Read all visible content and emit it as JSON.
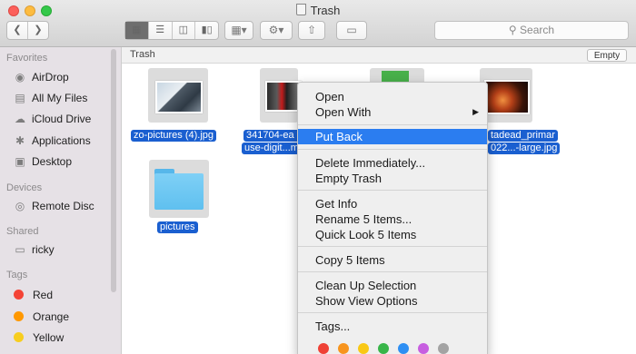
{
  "window": {
    "title": "Trash"
  },
  "toolbar": {
    "back_icon": "chevron-left-icon",
    "forward_icon": "chevron-right-icon",
    "view_modes": [
      "icon-view",
      "list-view",
      "column-view",
      "cover-flow-view"
    ],
    "arrange_icon": "grid-arrange-icon",
    "action_icon": "gear-icon",
    "share_icon": "share-icon",
    "tag_icon": "tag-icon",
    "search_placeholder": "Search"
  },
  "sidebar": {
    "favorites_header": "Favorites",
    "favorites": [
      {
        "label": "AirDrop",
        "icon": "airdrop-icon"
      },
      {
        "label": "All My Files",
        "icon": "all-files-icon"
      },
      {
        "label": "iCloud Drive",
        "icon": "cloud-icon"
      },
      {
        "label": "Applications",
        "icon": "applications-icon"
      },
      {
        "label": "Desktop",
        "icon": "desktop-icon"
      }
    ],
    "devices_header": "Devices",
    "devices": [
      {
        "label": "Remote Disc",
        "icon": "disc-icon"
      }
    ],
    "shared_header": "Shared",
    "shared": [
      {
        "label": "ricky",
        "icon": "computer-icon"
      }
    ],
    "tags_header": "Tags",
    "tags": [
      {
        "label": "Red",
        "color": "#f44336"
      },
      {
        "label": "Orange",
        "color": "#ff9800"
      },
      {
        "label": "Yellow",
        "color": "#f7cd1f"
      }
    ]
  },
  "pathbar": {
    "label": "Trash",
    "empty_button": "Empty"
  },
  "files": [
    {
      "name": "zo-pictures (4).jpg"
    },
    {
      "name_line1": "341704-ea",
      "name_line2": "use-digit...m"
    },
    {
      "name": ""
    },
    {
      "name_line1": "tadead_primar",
      "name_line2": "022...-large.jpg"
    },
    {
      "name": "pictures"
    }
  ],
  "context_menu": {
    "open": "Open",
    "open_with": "Open With",
    "put_back": "Put Back",
    "delete_immediately": "Delete Immediately...",
    "empty_trash": "Empty Trash",
    "get_info": "Get Info",
    "rename": "Rename 5 Items...",
    "quick_look": "Quick Look 5 Items",
    "copy": "Copy 5 Items",
    "clean_up": "Clean Up Selection",
    "show_view_options": "Show View Options",
    "tags": "Tags...",
    "tag_colors": [
      "#ef4136",
      "#f7941d",
      "#f9c815",
      "#38b549",
      "#2e8ff3",
      "#c75ee0",
      "#a3a3a3"
    ]
  }
}
